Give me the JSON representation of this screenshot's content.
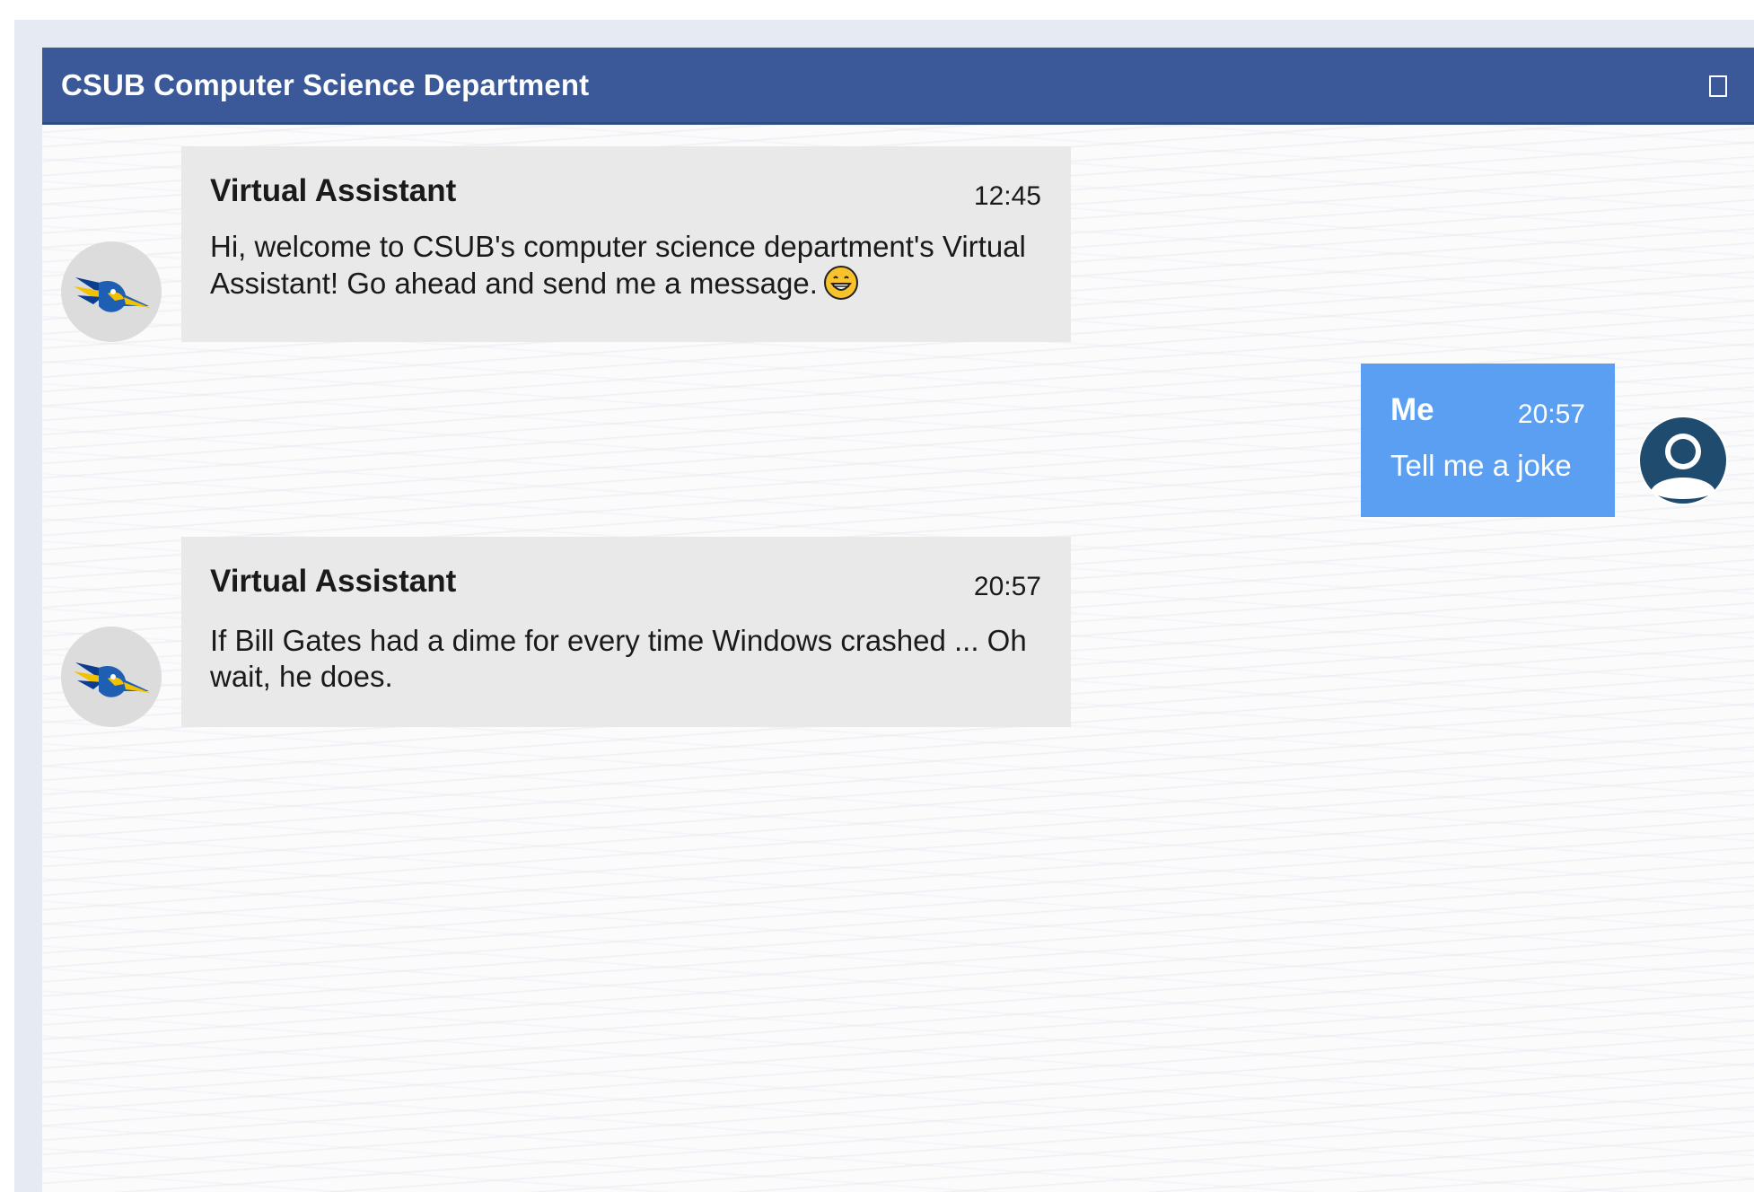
{
  "header": {
    "title": "CSUB Computer Science Department",
    "maximize_icon": "maximize-icon"
  },
  "messages": [
    {
      "sender": "Virtual Assistant",
      "time": "12:45",
      "text": "Hi, welcome to CSUB's computer science department's Virtual Assistant! Go ahead and send me a message.",
      "emoji": "grinning-face-icon",
      "avatar": "roadrunner-logo-icon"
    },
    {
      "sender": "Me",
      "time": "20:57",
      "text": "Tell me a joke",
      "avatar": "user-silhouette-icon"
    },
    {
      "sender": "Virtual Assistant",
      "time": "20:57",
      "text": "If Bill Gates had a dime for every time Windows crashed ... Oh wait, he does.",
      "avatar": "roadrunner-logo-icon"
    }
  ],
  "colors": {
    "header": "#3b5998",
    "bot_bubble": "#e9e9e9",
    "user_bubble": "#5b9ff3"
  }
}
